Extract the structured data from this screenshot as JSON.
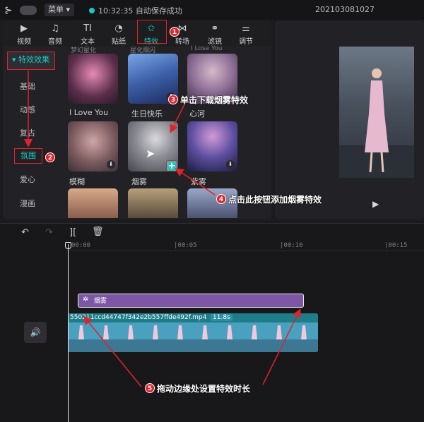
{
  "titlebar": {
    "logo_icon": "capcut-logo-icon",
    "menu_label": "菜单 ▾",
    "save_status": "10:32:35 自动保存成功",
    "project_title": "202103081027"
  },
  "toolbar": {
    "tools": [
      {
        "label": "视频",
        "icon": "video-icon",
        "glyph": "▶"
      },
      {
        "label": "音频",
        "icon": "audio-icon",
        "glyph": "♫"
      },
      {
        "label": "文本",
        "icon": "text-icon",
        "glyph": "TI"
      },
      {
        "label": "贴纸",
        "icon": "sticker-icon",
        "glyph": "◔"
      },
      {
        "label": "特效",
        "icon": "effects-star-icon",
        "glyph": "✩"
      },
      {
        "label": "转场",
        "icon": "transition-icon",
        "glyph": "⋈"
      },
      {
        "label": "滤镜",
        "icon": "filter-icon",
        "glyph": "⚭"
      },
      {
        "label": "调节",
        "icon": "adjust-icon",
        "glyph": "⚌"
      }
    ],
    "active_tool": "特效",
    "accent_color": "#1fc7c2"
  },
  "categories": {
    "header": "特效效果",
    "items": [
      "基础",
      "动感",
      "复古",
      "氛围",
      "爱心",
      "漫画"
    ],
    "active": "氛围"
  },
  "effects": {
    "scrolled_labels": [
      "梦幻星化",
      "星化烟闪",
      "I Lose You"
    ],
    "row1": [
      {
        "label": "I Love You",
        "download": false
      },
      {
        "label": "生日快乐",
        "download": true
      },
      {
        "label": "心河",
        "download": false
      }
    ],
    "row2": [
      {
        "label": "模糊",
        "download": true
      },
      {
        "label": "烟雾",
        "download": false
      },
      {
        "label": "紫雾",
        "download": true
      }
    ],
    "add_icon": "+"
  },
  "preview": {
    "play_icon": "▶"
  },
  "timeline": {
    "tools": [
      "↶",
      "↷",
      "][",
      "🗑"
    ],
    "ticks": [
      "00:00",
      "|00:05",
      "|00:10",
      "|00:15"
    ],
    "effect_clip_label": "烟雾",
    "effect_clip_icon": "✲",
    "video_clip_name": "550211ccd44747f342e2b557ffde492f.mp4",
    "video_clip_duration": "11.8s",
    "track_icon": "🔊"
  },
  "annotations": {
    "step1_badge": "1",
    "step2_badge": "2",
    "step3_badge": "3",
    "step3_text": "单击下载烟雾特效",
    "step4_badge": "4",
    "step4_text": "点击此按钮添加烟雾特效",
    "step5_badge": "5",
    "step5_text": "拖动边缘处设置特效时长",
    "color": "#e0222c"
  }
}
